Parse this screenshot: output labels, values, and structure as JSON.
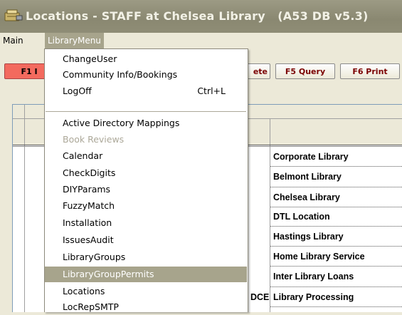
{
  "window": {
    "title": "Locations - STAFF at Chelsea Library",
    "version": "(A53 DB v5.3)"
  },
  "menubar": {
    "main": "Main",
    "library_menu": "LibraryMenu"
  },
  "toolbar": {
    "f1": "F1 I",
    "delete_fragment": "ete",
    "f5": "F5 Query",
    "f6": "F6 Print"
  },
  "dropdown": {
    "group1": [
      {
        "label": "ChangeUser"
      },
      {
        "label": "Community Info/Bookings"
      },
      {
        "label": "LogOff",
        "shortcut": "Ctrl+L"
      }
    ],
    "group2": [
      {
        "label": "Active Directory Mappings"
      },
      {
        "label": "Book Reviews",
        "disabled": true
      },
      {
        "label": "Calendar"
      },
      {
        "label": "CheckDigits"
      },
      {
        "label": "DIYParams"
      },
      {
        "label": "FuzzyMatch"
      },
      {
        "label": "Installation"
      },
      {
        "label": "IssuesAudit"
      },
      {
        "label": "LibraryGroups"
      },
      {
        "label": "LibraryGroupPermits",
        "selected": true
      },
      {
        "label": "Locations"
      },
      {
        "label": "LocRepSMTP"
      }
    ]
  },
  "grid": {
    "rows": [
      "Corporate Library",
      "Belmont Library",
      "Chelsea Library",
      "DTL Location",
      "Hastings Library",
      "Home Library Service",
      "Inter Library Loans",
      "Library Processing"
    ],
    "code_fragment": "DCE"
  },
  "colors": {
    "title_bar": "#8f8d76",
    "menu_highlight": "#A7A48C",
    "f1_button": "#F36A5E"
  }
}
